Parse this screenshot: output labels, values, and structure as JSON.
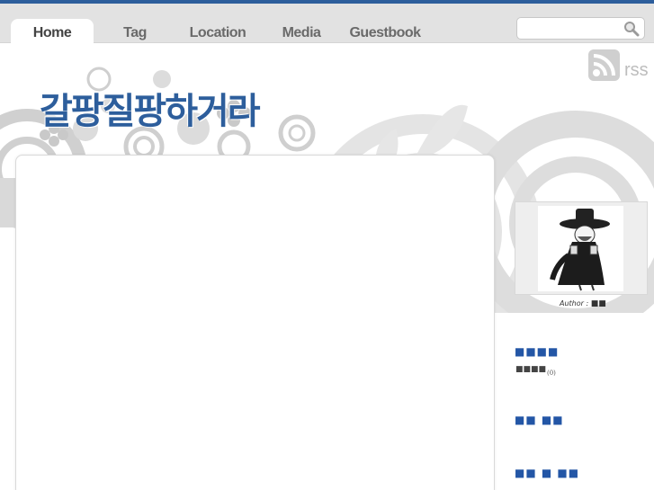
{
  "nav": {
    "tabs": [
      {
        "label": "Home",
        "active": true
      },
      {
        "label": "Tag"
      },
      {
        "label": "Location"
      },
      {
        "label": "Media"
      },
      {
        "label": "Guestbook"
      }
    ]
  },
  "search": {
    "placeholder": ""
  },
  "header": {
    "rss_label": "rss",
    "blog_title": "갈팡질팡하거라"
  },
  "sidebar": {
    "author_label": "Author : ",
    "author_name": "■■",
    "sections": [
      {
        "heading": "■■■■",
        "items": [
          {
            "label": "■■■■",
            "count": "(0)"
          }
        ]
      },
      {
        "heading": "■■ ■■"
      },
      {
        "heading": "■■ ■ ■■"
      }
    ]
  },
  "colors": {
    "accent": "#2d5e9c",
    "nav_bg": "#e2e2e2",
    "heading": "#2356a6"
  },
  "icons": {
    "search": "magnifier-icon",
    "rss": "rss-icon"
  }
}
